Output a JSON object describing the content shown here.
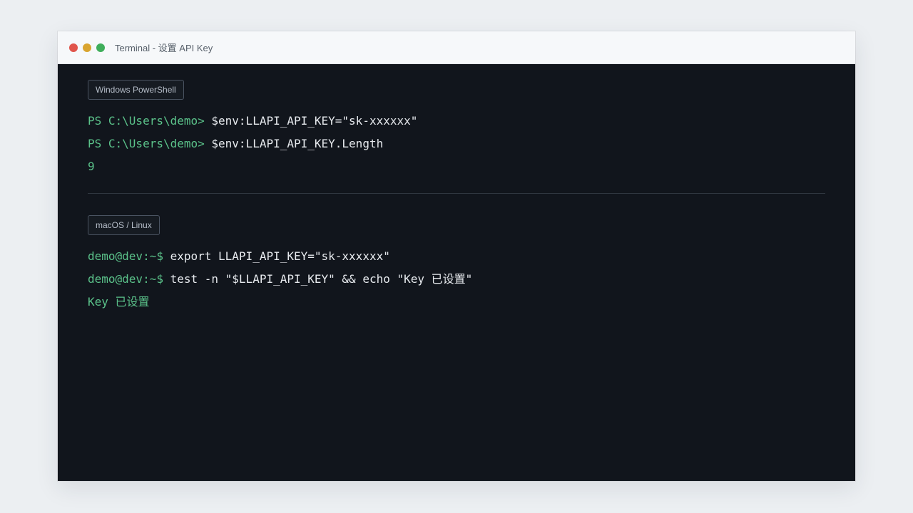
{
  "window": {
    "title": "Terminal - 设置 API Key"
  },
  "sections": [
    {
      "badge": "Windows PowerShell",
      "lines": [
        {
          "prompt": "PS C:\\Users\\demo> ",
          "command": "$env:LLAPI_API_KEY=\"sk-xxxxxx\""
        },
        {
          "prompt": "PS C:\\Users\\demo> ",
          "command": "$env:LLAPI_API_KEY.Length"
        },
        {
          "output": "9"
        }
      ]
    },
    {
      "badge": "macOS / Linux",
      "lines": [
        {
          "prompt": "demo@dev:~$ ",
          "command": "export LLAPI_API_KEY=\"sk-xxxxxx\""
        },
        {
          "prompt": "demo@dev:~$ ",
          "command": "test -n \"$LLAPI_API_KEY\" && echo \"Key 已设置\""
        },
        {
          "output": "Key 已设置"
        }
      ]
    }
  ],
  "colors": {
    "terminal_bg": "#11151c",
    "prompt": "#5bc28a",
    "command": "#e7eaee",
    "close": "#e0544b",
    "minimize": "#d9a42f",
    "maximize": "#3fae5b"
  }
}
